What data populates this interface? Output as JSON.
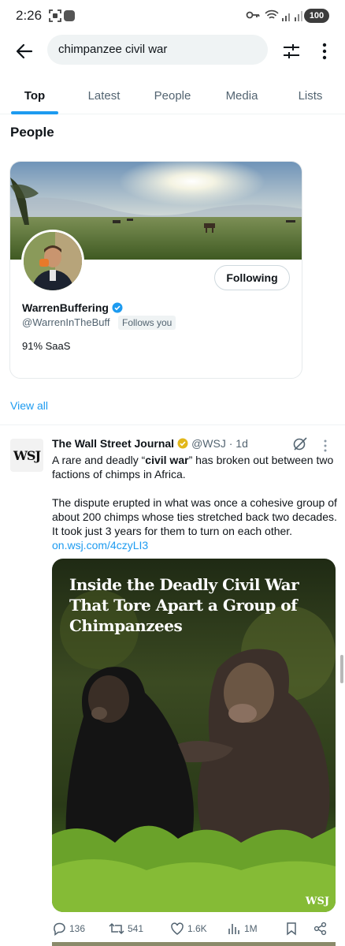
{
  "status_bar": {
    "time": "2:26",
    "battery": "100"
  },
  "search": {
    "query": "chimpanzee civil war"
  },
  "tabs": [
    {
      "label": "Top",
      "active": true
    },
    {
      "label": "Latest"
    },
    {
      "label": "People"
    },
    {
      "label": "Media"
    },
    {
      "label": "Lists"
    }
  ],
  "people": {
    "section_title": "People",
    "card": {
      "name": "WarrenBuffering",
      "handle": "@WarrenInTheBuff",
      "follows_you": "Follows you",
      "bio": "91% SaaS",
      "follow_button": "Following",
      "verified_color": "#1d9bf0"
    },
    "view_all": "View all"
  },
  "tweet": {
    "avatar_text": "WSJ",
    "author": "The Wall Street Journal",
    "handle_time": "@WSJ · 1d",
    "text_1_pre": "A rare and deadly “",
    "text_1_bold": "civil war",
    "text_1_post": "” has broken out between two factions of chimps in Africa.",
    "text_2": "The dispute erupted in what was once a cohesive group of about 200 chimps whose ties stretched back two decades. It took just 3 years for them to turn on each other. ",
    "link": "on.wsj.com/4czyLI3",
    "media_headline": "Inside the Deadly Civil War That Tore Apart a Group of Chimpanzees",
    "media_watermark": "WSJ",
    "stats": {
      "replies": "136",
      "reposts": "541",
      "likes": "1.6K",
      "views": "1M"
    }
  },
  "colors": {
    "accent": "#1d9bf0",
    "text": "#0f1419",
    "secondary": "#536471",
    "gold_badge": "#e2b719"
  }
}
